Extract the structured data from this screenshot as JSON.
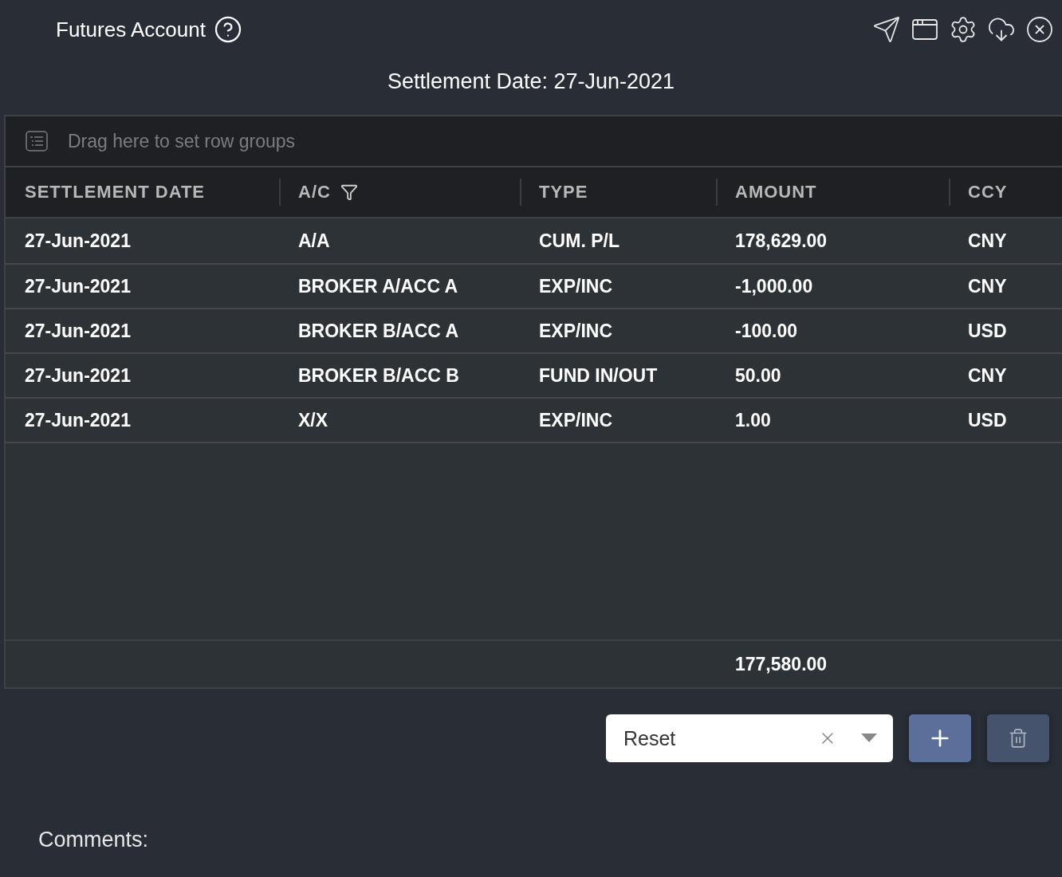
{
  "window": {
    "title": "Futures Account"
  },
  "settlement_date": "Settlement Date: 27-Jun-2021",
  "group_bar": {
    "placeholder": "Drag here to set row groups"
  },
  "table": {
    "columns": [
      {
        "label": "SETTLEMENT DATE",
        "filtered": false
      },
      {
        "label": "A/C",
        "filtered": true
      },
      {
        "label": "TYPE",
        "filtered": false
      },
      {
        "label": "AMOUNT",
        "filtered": false
      },
      {
        "label": "CCY",
        "filtered": false
      }
    ],
    "rows": [
      [
        "27-Jun-2021",
        "A/A",
        "CUM. P/L",
        "178,629.00",
        "CNY"
      ],
      [
        "27-Jun-2021",
        "BROKER A/ACC A",
        "EXP/INC",
        "-1,000.00",
        "CNY"
      ],
      [
        "27-Jun-2021",
        "BROKER B/ACC A",
        "EXP/INC",
        "-100.00",
        "USD"
      ],
      [
        "27-Jun-2021",
        "BROKER B/ACC B",
        "FUND IN/OUT",
        "50.00",
        "CNY"
      ],
      [
        "27-Jun-2021",
        "X/X",
        "EXP/INC",
        "1.00",
        "USD"
      ]
    ],
    "total": {
      "amount": "177,580.00"
    }
  },
  "select": {
    "value": "Reset"
  },
  "buttons": [
    {
      "kind": "add",
      "disabled": false
    },
    {
      "kind": "delete",
      "disabled": true
    }
  ],
  "comments_label": "Comments:"
}
